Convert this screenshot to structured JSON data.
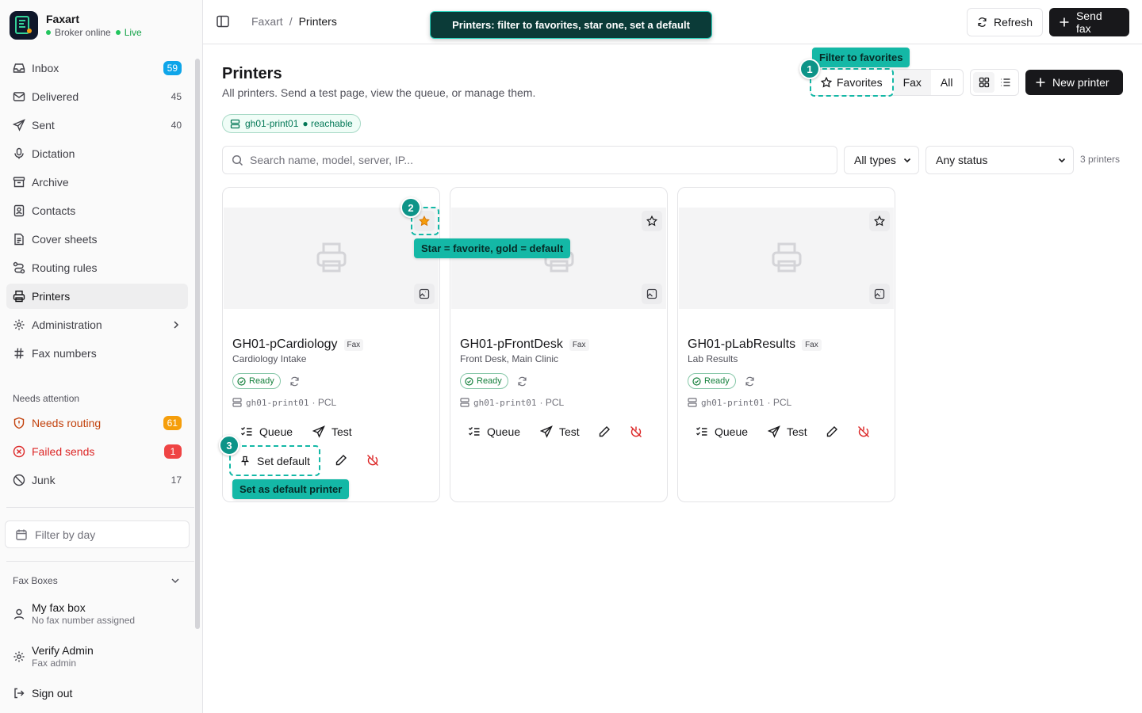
{
  "brand": {
    "name": "Faxart",
    "status": "Broker online",
    "live": "Live"
  },
  "nav": [
    {
      "label": "Inbox",
      "count": "59",
      "badge": "#0ea5e9"
    },
    {
      "label": "Delivered",
      "count": "45"
    },
    {
      "label": "Sent",
      "count": "40"
    },
    {
      "label": "Dictation"
    },
    {
      "label": "Archive"
    },
    {
      "label": "Contacts"
    },
    {
      "label": "Cover sheets"
    },
    {
      "label": "Routing rules"
    },
    {
      "label": "Printers",
      "active": true
    },
    {
      "label": "Administration"
    },
    {
      "label": "Fax numbers"
    }
  ],
  "attention": {
    "title": "Needs attention",
    "items": [
      {
        "label": "Needs routing",
        "count": "61",
        "badge": "#f59e0b"
      },
      {
        "label": "Failed sends",
        "count": "1",
        "badge": "#ef4444"
      },
      {
        "label": "Junk",
        "count": "17"
      }
    ]
  },
  "filter_day": {
    "placeholder": "Filter by day"
  },
  "fax_boxes": {
    "title": "Fax Boxes",
    "my_box": "My fax box",
    "my_box_sub": "No fax number assigned"
  },
  "user": {
    "name": "Verify Admin",
    "role": "Fax admin",
    "sign_out": "Sign out"
  },
  "breadcrumb": {
    "root": "Faxart",
    "sep": "/",
    "current": "Printers"
  },
  "tour": {
    "banner": "Printers: filter to favorites, star one, set a default",
    "step1": "1",
    "tip1": "Filter to favorites",
    "step2": "2",
    "tip2": "Star = favorite, gold = default",
    "step3": "3",
    "tip3": "Set as default printer"
  },
  "header": {
    "refresh": "Refresh",
    "send_fax": "Send fax",
    "new_printer": "New printer"
  },
  "page": {
    "title": "Printers",
    "subtitle": "All printers. Send a test page, view the queue, or manage them."
  },
  "server_chip": {
    "name": "gh01-print01",
    "state": "● reachable"
  },
  "segment": {
    "favorites": "Favorites",
    "fax": "Fax",
    "all": "All"
  },
  "search": {
    "placeholder": "Search name, model, server, IP..."
  },
  "filters": {
    "type": "All types",
    "status": "Any status",
    "count": "3 printers"
  },
  "printers": [
    {
      "name": "GH01-pCardiology",
      "type": "Fax",
      "location": "Cardiology Intake",
      "status": "Ready",
      "server": "gh01-print01",
      "lang": "· PCL",
      "favorite": true
    },
    {
      "name": "GH01-pFrontDesk",
      "type": "Fax",
      "location": "Front Desk, Main Clinic",
      "status": "Ready",
      "server": "gh01-print01",
      "lang": "· PCL",
      "favorite": false
    },
    {
      "name": "GH01-pLabResults",
      "type": "Fax",
      "location": "Lab Results",
      "status": "Ready",
      "server": "gh01-print01",
      "lang": "· PCL",
      "favorite": false
    }
  ],
  "card_actions": {
    "queue": "Queue",
    "test": "Test",
    "set_default": "Set default"
  },
  "colors": {
    "accent": "#14b8a6",
    "gold": "#f59e0b",
    "danger": "#dc2626",
    "success": "#16a34a"
  }
}
